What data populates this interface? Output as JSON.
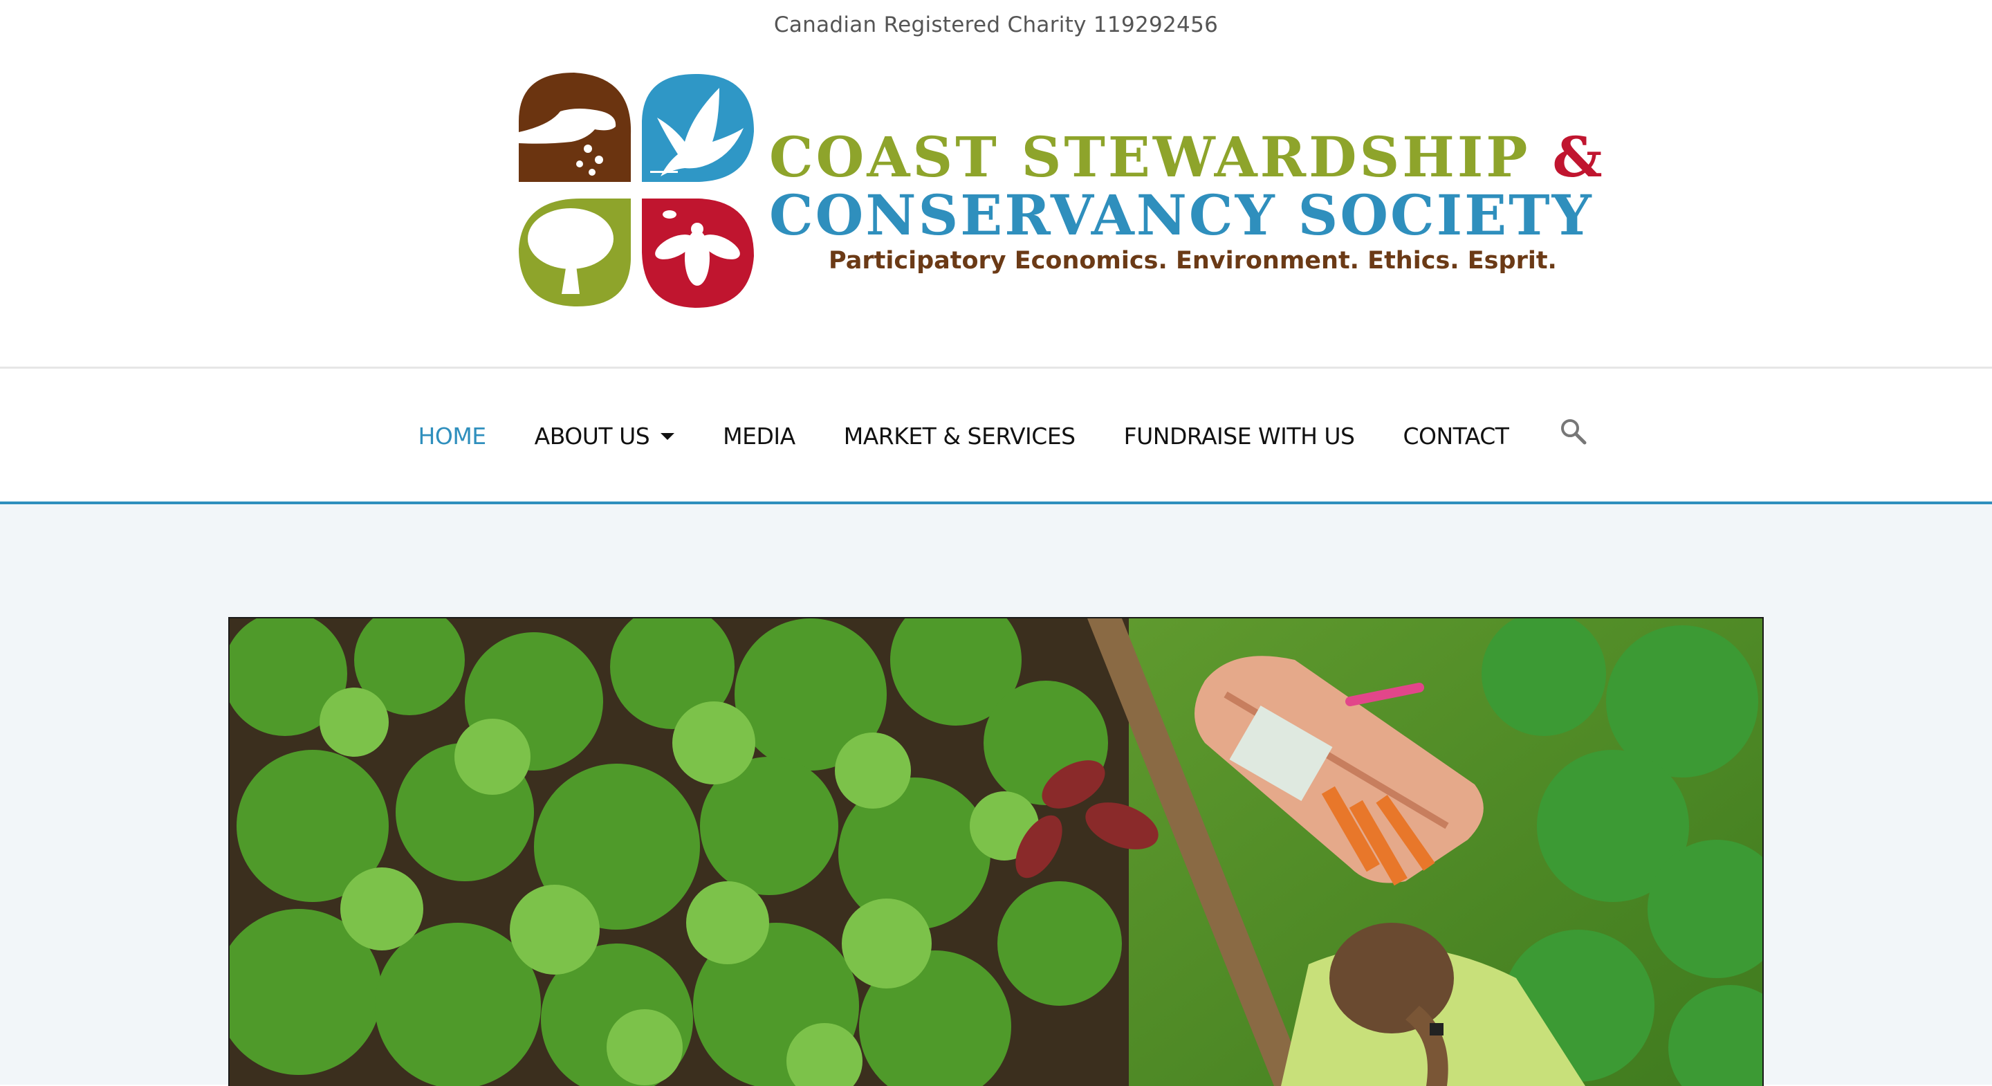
{
  "header": {
    "charity_note": "Canadian Registered Charity 119292456"
  },
  "logo": {
    "line1": "COAST STEWARDSHIP",
    "ampersand": "&",
    "line2": "CONSERVANCY SOCIETY",
    "tagline": "Participatory Economics. Environment. Ethics. Esprit.",
    "petal_colors": [
      "#6b3410",
      "#2f97c6",
      "#8ea42b",
      "#c0152f"
    ],
    "icons": [
      "hand-seeds-icon",
      "eagle-icon",
      "tree-icon",
      "bee-icon"
    ]
  },
  "nav": {
    "items": [
      {
        "label": "HOME",
        "active": true
      },
      {
        "label": "ABOUT US",
        "has_dropdown": true
      },
      {
        "label": "MEDIA"
      },
      {
        "label": "MARKET & SERVICES"
      },
      {
        "label": "FUNDRAISE WITH US"
      },
      {
        "label": "CONTACT"
      }
    ],
    "search_icon": "search-icon"
  },
  "colors": {
    "accent": "#2f8fbd",
    "content_bg": "#f2f6f9"
  },
  "hero": {
    "image_subject": "garden-photo"
  }
}
